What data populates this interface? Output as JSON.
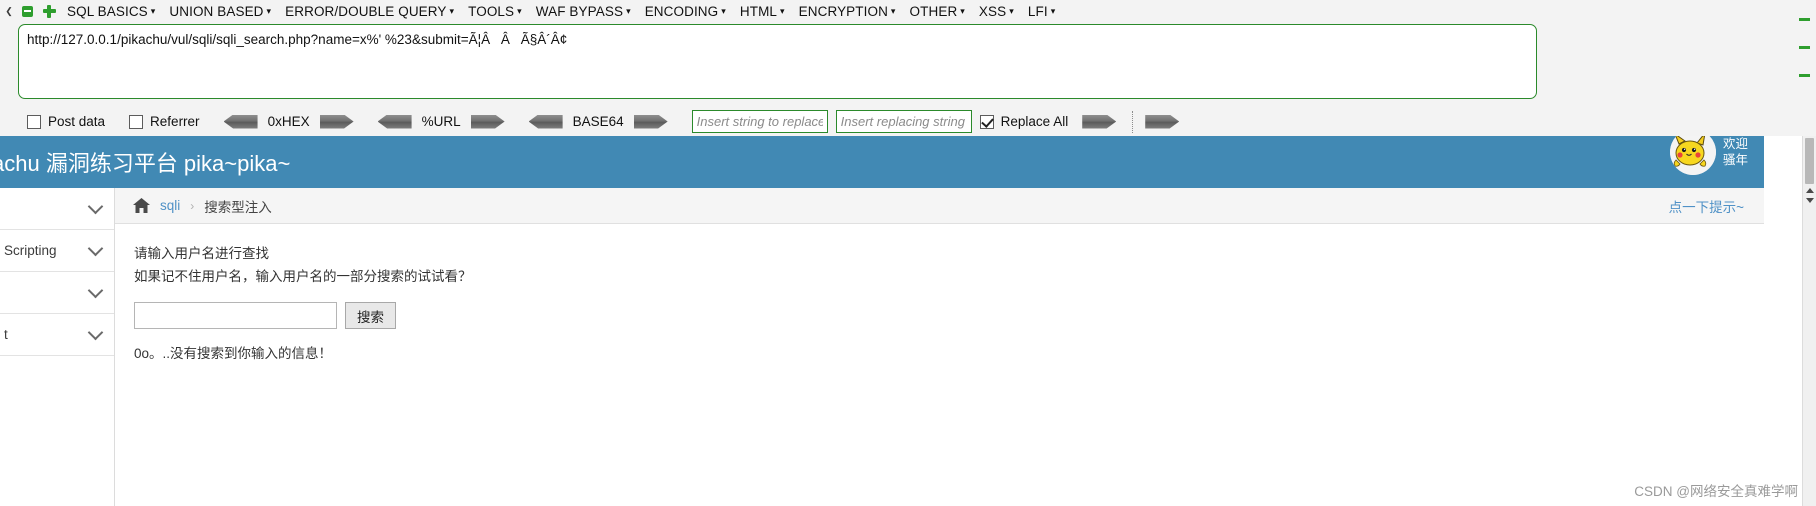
{
  "hackbar": {
    "menu_items": [
      {
        "label": "SQL BASICS",
        "caret": "▾"
      },
      {
        "label": "UNION BASED",
        "caret": "▾"
      },
      {
        "label": "ERROR/DOUBLE QUERY",
        "caret": "▾"
      },
      {
        "label": "TOOLS",
        "caret": "▾"
      },
      {
        "label": "WAF BYPASS",
        "caret": "▾"
      },
      {
        "label": "ENCODING",
        "caret": "▾"
      },
      {
        "label": "HTML",
        "caret": "▾"
      },
      {
        "label": "ENCRYPTION",
        "caret": "▾"
      },
      {
        "label": "OTHER",
        "caret": "▾"
      },
      {
        "label": "XSS",
        "caret": "▾"
      },
      {
        "label": "LFI",
        "caret": "▾"
      }
    ],
    "url_value": "http://127.0.0.1/pikachu/vul/sqli/sqli_search.php?name=x%' %23&submit=Ã¦ÂÂÃ§Â´Â¢",
    "post_data_label": "Post data",
    "referrer_label": "Referrer",
    "post_data_checked": false,
    "referrer_checked": false,
    "converters": [
      {
        "label": "0xHEX"
      },
      {
        "label": "%URL"
      },
      {
        "label": "BASE64"
      }
    ],
    "replace_from_placeholder": "Insert string to replace",
    "replace_to_placeholder": "Insert replacing string",
    "replace_from_value": "",
    "replace_to_value": "",
    "replace_all_label": "Replace All",
    "replace_all_checked": true,
    "icons": {
      "collapse": "minus-icon",
      "expand": "plus-icon"
    }
  },
  "page": {
    "header_title": "achu 漏洞练习平台 pika~pika~",
    "welcome_line1": "欢迎",
    "welcome_line2": "骚年",
    "sidebar_items": [
      {
        "label": ""
      },
      {
        "label": "Scripting"
      },
      {
        "label": ""
      },
      {
        "label": "t"
      }
    ],
    "breadcrumb": {
      "home_icon": "home-icon",
      "link": "sqli",
      "separator": "›",
      "current": "搜索型注入"
    },
    "hint_link": "点一下提示~",
    "main": {
      "line1": "请输入用户名进行查找",
      "line2": "如果记不住用户名，输入用户名的一部分搜索的试试看？",
      "search_value": "",
      "search_placeholder": "",
      "search_button": "搜索",
      "result": "0o。..没有搜索到你输入的信息！"
    },
    "watermark": "CSDN @网络安全真难学啊"
  },
  "colors": {
    "hackbar_bg": "#f3f3f3",
    "accent_green": "#2b8a2b",
    "header_blue": "#4189b4",
    "link_blue": "#4f91c6"
  }
}
